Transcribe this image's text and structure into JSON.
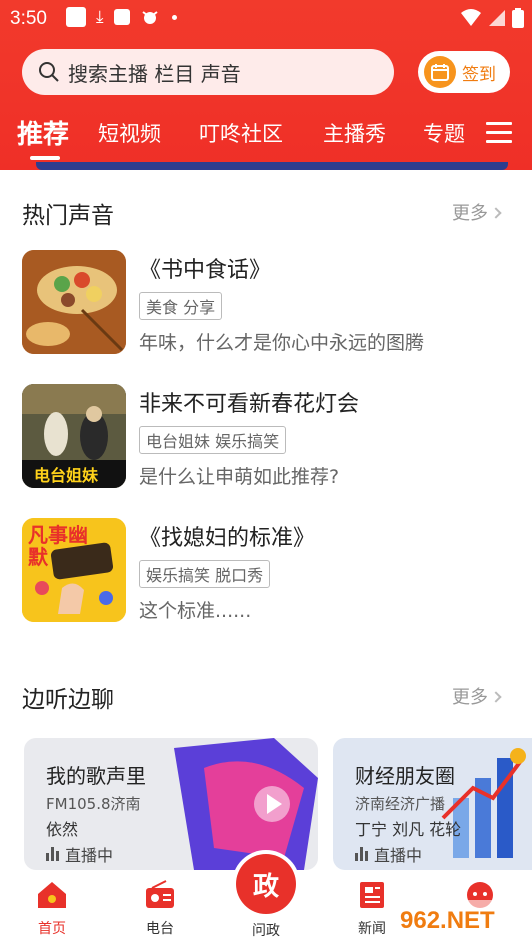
{
  "status_bar": {
    "time": "3:50"
  },
  "search": {
    "placeholder": "搜索主播 栏目 声音"
  },
  "checkin": {
    "label": "签到"
  },
  "tabs": [
    {
      "label": "推荐",
      "active": true
    },
    {
      "label": "短视频"
    },
    {
      "label": "叮咚社区"
    },
    {
      "label": "主播秀"
    },
    {
      "label": "专题"
    }
  ],
  "hot_audio": {
    "title": "热门声音",
    "more": "更多",
    "items": [
      {
        "title": "《书中食话》",
        "tag": "美食 分享",
        "desc": "年味，什么才是你心中永远的图腾"
      },
      {
        "title": "非来不可看新春花灯会",
        "tag": "电台姐妹 娱乐搞笑",
        "desc": "是什么让申萌如此推荐?",
        "thumb_text": "电台姐妹"
      },
      {
        "title": "《找媳妇的标准》",
        "tag": "娱乐搞笑 脱口秀",
        "desc": "这个标准......",
        "thumb_text": "凡事幽默"
      }
    ]
  },
  "listen_chat": {
    "title": "边听边聊",
    "more": "更多",
    "cards": [
      {
        "title": "我的歌声里",
        "station": "FM105.8济南",
        "host": "依然",
        "status": "直播中"
      },
      {
        "title": "财经朋友圈",
        "station": "济南经济广播",
        "host": "丁宁 刘凡 花轮",
        "status": "直播中"
      }
    ]
  },
  "bottom_nav": [
    {
      "label": "首页",
      "active": true
    },
    {
      "label": "电台"
    },
    {
      "label": "问政"
    },
    {
      "label": "新闻"
    }
  ],
  "watermark": "962.NET"
}
